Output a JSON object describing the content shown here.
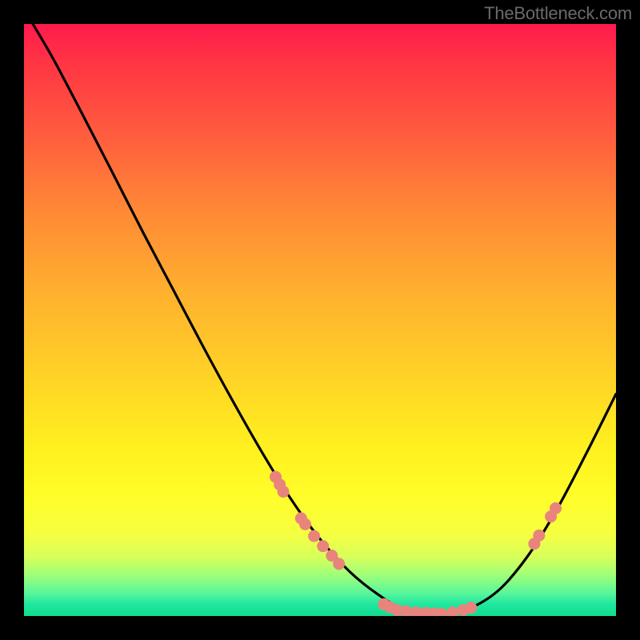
{
  "attribution": "TheBottleneck.com",
  "chart_data": {
    "type": "line",
    "title": "",
    "xlabel": "",
    "ylabel": "",
    "x_range_fraction": [
      0.0,
      1.0
    ],
    "y_range_fraction": [
      0.0,
      1.0
    ],
    "curve_note": "values are fractions of inner plot height measured from top (0) to bottom (1), x is fraction of inner plot width",
    "curve": {
      "x": [
        0.015,
        0.05,
        0.1,
        0.15,
        0.2,
        0.25,
        0.3,
        0.35,
        0.4,
        0.45,
        0.5,
        0.55,
        0.6,
        0.645,
        0.7,
        0.745,
        0.8,
        0.85,
        0.9,
        0.95,
        1.0
      ],
      "y": [
        0.0,
        0.06,
        0.155,
        0.252,
        0.35,
        0.445,
        0.54,
        0.632,
        0.72,
        0.801,
        0.87,
        0.925,
        0.965,
        0.99,
        0.995,
        0.99,
        0.958,
        0.9,
        0.82,
        0.725,
        0.625
      ]
    },
    "marker_clusters": [
      {
        "label": "left-descending-cluster",
        "color": "#e9847c",
        "points": [
          {
            "x": 0.425,
            "y": 0.765
          },
          {
            "x": 0.432,
            "y": 0.778
          },
          {
            "x": 0.438,
            "y": 0.79
          },
          {
            "x": 0.468,
            "y": 0.835
          },
          {
            "x": 0.475,
            "y": 0.845
          },
          {
            "x": 0.49,
            "y": 0.865
          },
          {
            "x": 0.505,
            "y": 0.882
          },
          {
            "x": 0.52,
            "y": 0.898
          },
          {
            "x": 0.532,
            "y": 0.912
          }
        ]
      },
      {
        "label": "valley-cluster",
        "color": "#e9847c",
        "points": [
          {
            "x": 0.608,
            "y": 0.98
          },
          {
            "x": 0.618,
            "y": 0.985
          },
          {
            "x": 0.63,
            "y": 0.99
          },
          {
            "x": 0.645,
            "y": 0.992
          },
          {
            "x": 0.662,
            "y": 0.994
          },
          {
            "x": 0.678,
            "y": 0.995
          },
          {
            "x": 0.692,
            "y": 0.996
          },
          {
            "x": 0.705,
            "y": 0.996
          },
          {
            "x": 0.724,
            "y": 0.994
          },
          {
            "x": 0.742,
            "y": 0.99
          },
          {
            "x": 0.755,
            "y": 0.986
          }
        ]
      },
      {
        "label": "right-ascending-cluster",
        "color": "#e9847c",
        "points": [
          {
            "x": 0.862,
            "y": 0.878
          },
          {
            "x": 0.87,
            "y": 0.864
          },
          {
            "x": 0.89,
            "y": 0.832
          },
          {
            "x": 0.898,
            "y": 0.818
          }
        ]
      }
    ],
    "colors": {
      "curve_stroke": "#000000",
      "marker_fill": "#e9847c",
      "background_top": "#ff1a4d",
      "background_bottom": "#12dc8f",
      "frame_outer": "#000000"
    }
  }
}
